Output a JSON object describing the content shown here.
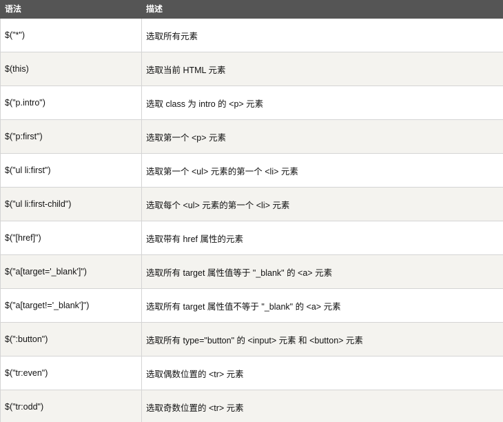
{
  "table": {
    "headers": [
      "语法",
      "描述"
    ],
    "rows": [
      {
        "syntax": "$(\"*\")",
        "description": "选取所有元素"
      },
      {
        "syntax": "$(this)",
        "description": "选取当前 HTML 元素"
      },
      {
        "syntax": "$(\"p.intro\")",
        "description": "选取 class 为 intro 的 <p> 元素"
      },
      {
        "syntax": "$(\"p:first\")",
        "description": "选取第一个 <p> 元素"
      },
      {
        "syntax": "$(\"ul li:first\")",
        "description": "选取第一个 <ul> 元素的第一个 <li> 元素"
      },
      {
        "syntax": "$(\"ul li:first-child\")",
        "description": "选取每个 <ul> 元素的第一个 <li> 元素"
      },
      {
        "syntax": "$(\"[href]\")",
        "description": "选取带有 href 属性的元素"
      },
      {
        "syntax": "$(\"a[target='_blank']\")",
        "description": "选取所有 target 属性值等于 \"_blank\" 的 <a> 元素"
      },
      {
        "syntax": "$(\"a[target!='_blank']\")",
        "description": "选取所有 target 属性值不等于 \"_blank\" 的 <a> 元素"
      },
      {
        "syntax": "$(\":button\")",
        "description": "选取所有 type=\"button\" 的 <input> 元素 和 <button> 元素"
      },
      {
        "syntax": "$(\"tr:even\")",
        "description": "选取偶数位置的 <tr> 元素"
      },
      {
        "syntax": "$(\"tr:odd\")",
        "description": "选取奇数位置的 <tr> 元素"
      }
    ]
  },
  "colors": {
    "header_bg": "#555555",
    "header_text": "#ffffff",
    "row_alt_bg": "#f4f3ef",
    "border": "#d4d4d4"
  }
}
